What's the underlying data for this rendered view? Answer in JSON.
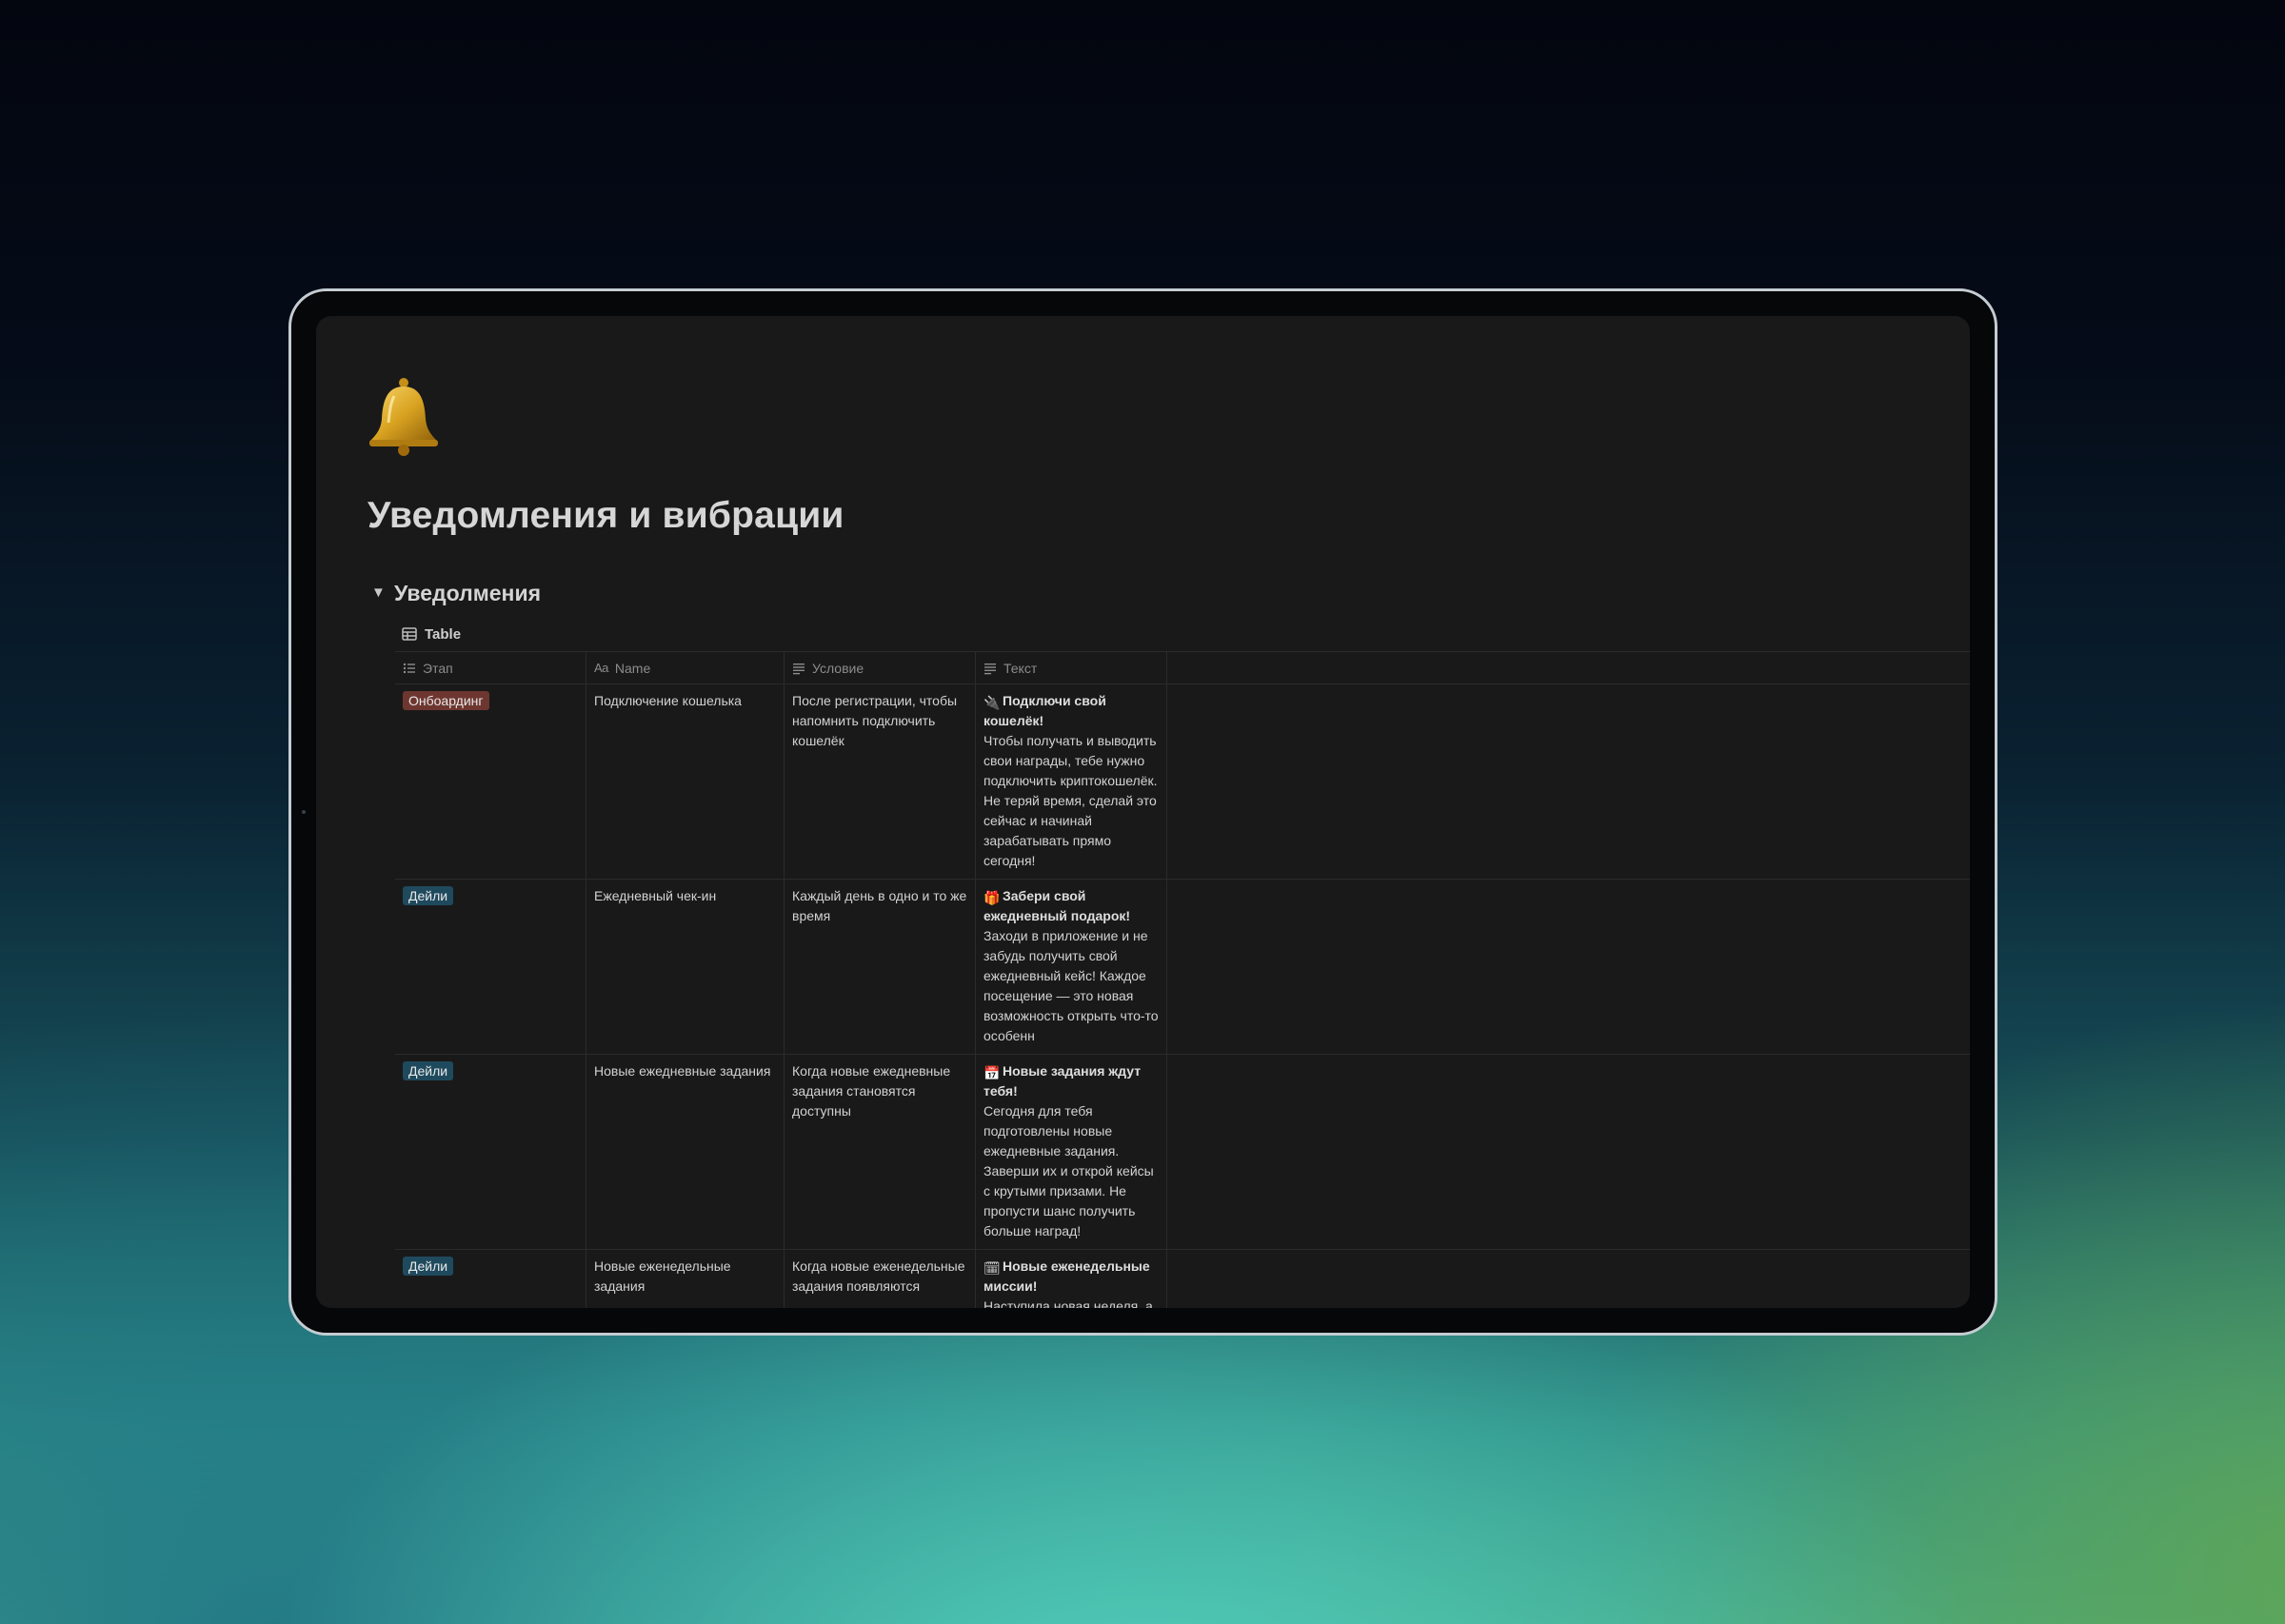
{
  "page": {
    "title": "Уведомления и вибрации"
  },
  "section": {
    "heading": "Уведолмения",
    "view_label": "Table"
  },
  "table": {
    "columns": {
      "stage": "Этап",
      "name_prefix": "Aa",
      "name": "Name",
      "condition": "Условие",
      "text": "Текст"
    },
    "rows": [
      {
        "stage": "Онбоардинг",
        "name": "Подключение кошелька",
        "condition": "После регистрации, чтобы напомнить подключить кошелёк",
        "text_emoji": "🔌",
        "text_title": "Подключи свой кошелёк!",
        "text_body": "Чтобы получать и выводить свои награды, тебе нужно подключить криптокошелёк. Не теряй время, сделай это сейчас и начинай зарабатывать прямо сегодня!"
      },
      {
        "stage": "Дейли",
        "name": "Ежедневный чек-ин",
        "condition": "Каждый день в одно и то же время",
        "text_emoji": "🎁",
        "text_title": "Забери свой ежедневный подарок!",
        "text_body": "Заходи в приложение и не забудь получить свой ежедневный кейс! Каждое посещение — это новая возможность открыть что-то особенн"
      },
      {
        "stage": "Дейли",
        "name": "Новые ежедневные задания",
        "condition": "Когда новые ежедневные задания становятся доступны",
        "text_emoji": "📅",
        "text_title": "Новые задания ждут тебя!",
        "text_body": "Сегодня для тебя подготовлены новые ежедневные задания. Заверши их и открой кейсы с крутыми призами. Не пропусти шанс получить больше наград!"
      },
      {
        "stage": "Дейли",
        "name": "Новые еженедельные задания",
        "condition": "Когда новые еженедельные задания появляются",
        "text_emoji": "🗓",
        "text_title": "Новые еженедельные миссии!",
        "text_body": "Наступила новая неделя, а"
      }
    ]
  },
  "colors": {
    "page_bg": "#191919",
    "tag_onboarding": "#6e3630",
    "tag_daily": "#1f4a5d",
    "text": "#d2d2d2",
    "muted": "#8c8c8c"
  },
  "icons": {
    "page": "bell-icon",
    "toggle": "triangle-down-icon",
    "view": "table-icon",
    "stage_column": "list-icon",
    "text_columns": "text-lines-icon"
  }
}
